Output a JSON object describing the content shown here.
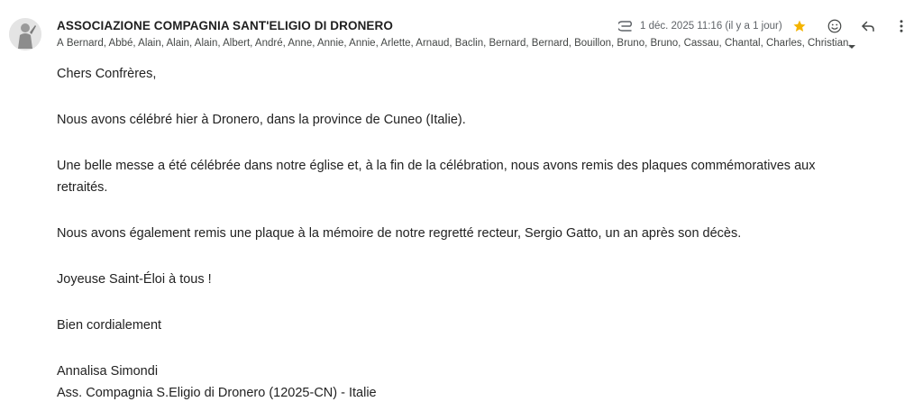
{
  "header": {
    "sender_name": "ASSOCIAZIONE COMPAGNIA SANT'ELIGIO DI DRONERO",
    "recipients": "À Bernard, Abbé, Alain, Alain, Alain, Albert, André, Anne, Annie, Annie, Arlette, Arnaud, Baclin, Bernard, Bernard, Bouillon, Bruno, Bruno, Cassau, Chantal, Charles, Christian,",
    "date": "1 déc. 2025 11:16 (il y a 1 jour)"
  },
  "icons": {
    "avatar": "avatar-statue",
    "attachment": "paperclip-icon",
    "star": "star-icon",
    "emoji": "emoji-icon",
    "reply": "reply-icon",
    "more": "more-vert-icon",
    "recipients_toggle": "caret-down-icon"
  },
  "colors": {
    "star": "#f4b400",
    "text": "#222222",
    "secondary_text": "#5f6368"
  },
  "message": {
    "greeting": "Chers Confrères,",
    "paragraph1": "Nous avons célébré hier à Dronero, dans la province de Cuneo (Italie).",
    "paragraph2": "Une belle messe a été célébrée dans notre église et, à la fin de la célébration, nous avons remis des plaques commémoratives aux retraités.",
    "paragraph3": "Nous avons également remis une plaque à la mémoire de notre regretté recteur, Sergio Gatto, un an après son décès.",
    "wishes": "Joyeuse Saint-Éloi à tous !",
    "closing": "Bien cordialement",
    "signature_name": "Annalisa Simondi",
    "signature_org": "Ass. Compagnia S.Eligio di Dronero (12025-CN) - Italie"
  }
}
